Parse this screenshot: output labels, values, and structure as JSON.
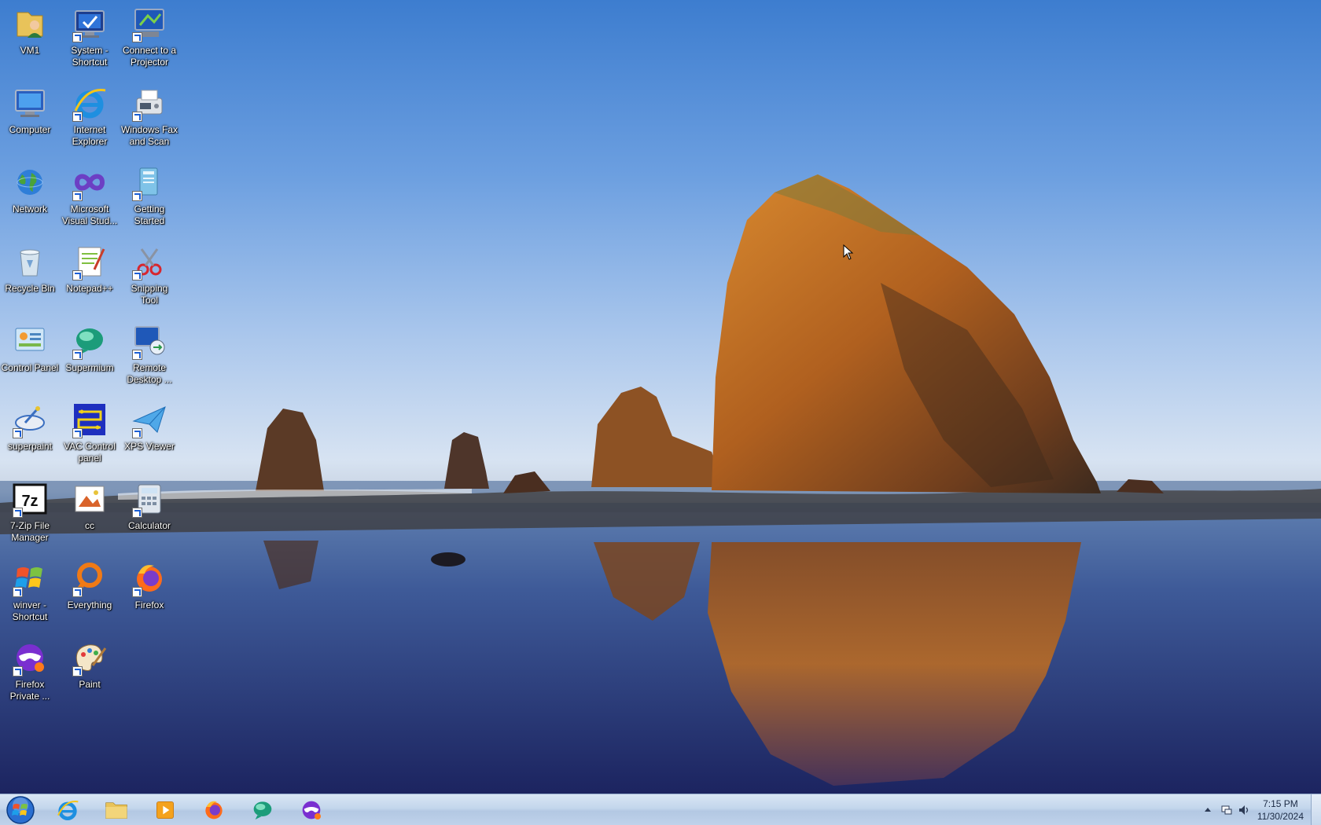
{
  "desktop": {
    "icons": [
      {
        "name": "vm1-icon",
        "label": "VM1",
        "icon": "user-folder",
        "shortcut": false
      },
      {
        "name": "system-shortcut-icon",
        "label": "System -\nShortcut",
        "icon": "system-monitor",
        "shortcut": true
      },
      {
        "name": "connect-projector-icon",
        "label": "Connect to a\nProjector",
        "icon": "projector-monitor",
        "shortcut": true
      },
      {
        "name": "computer-icon",
        "label": "Computer",
        "icon": "computer",
        "shortcut": false
      },
      {
        "name": "internet-explorer-icon",
        "label": "Internet\nExplorer",
        "icon": "ie",
        "shortcut": true
      },
      {
        "name": "windows-fax-icon",
        "label": "Windows Fax\nand Scan",
        "icon": "fax",
        "shortcut": true
      },
      {
        "name": "network-icon",
        "label": "Network",
        "icon": "globe",
        "shortcut": false
      },
      {
        "name": "visual-studio-icon",
        "label": "Microsoft\nVisual Stud...",
        "icon": "infinity",
        "shortcut": true
      },
      {
        "name": "getting-started-icon",
        "label": "Getting\nStarted",
        "icon": "getting-started",
        "shortcut": true
      },
      {
        "name": "recycle-bin-icon",
        "label": "Recycle Bin",
        "icon": "recycle-bin",
        "shortcut": false
      },
      {
        "name": "notepadpp-icon",
        "label": "Notepad++",
        "icon": "notepad",
        "shortcut": true
      },
      {
        "name": "snipping-tool-icon",
        "label": "Snipping\nTool",
        "icon": "scissors",
        "shortcut": true
      },
      {
        "name": "control-panel-icon",
        "label": "Control Panel",
        "icon": "control-panel",
        "shortcut": false
      },
      {
        "name": "supermium-icon",
        "label": "Supermium",
        "icon": "supermium",
        "shortcut": true
      },
      {
        "name": "remote-desktop-icon",
        "label": "Remote\nDesktop ...",
        "icon": "remote-desktop",
        "shortcut": true
      },
      {
        "name": "superpaint-icon",
        "label": "superpaint",
        "icon": "superpaint",
        "shortcut": true
      },
      {
        "name": "vac-control-panel-icon",
        "label": "VAC Control\npanel",
        "icon": "vac",
        "shortcut": true
      },
      {
        "name": "xps-viewer-icon",
        "label": "XPS Viewer",
        "icon": "paper-plane",
        "shortcut": true
      },
      {
        "name": "7zip-icon",
        "label": "7-Zip File\nManager",
        "icon": "7z",
        "shortcut": true
      },
      {
        "name": "cc-icon",
        "label": "cc",
        "icon": "image-file",
        "shortcut": false
      },
      {
        "name": "calculator-icon",
        "label": "Calculator",
        "icon": "calculator",
        "shortcut": true
      },
      {
        "name": "winver-shortcut-icon",
        "label": "winver -\nShortcut",
        "icon": "windows-flag",
        "shortcut": true
      },
      {
        "name": "everything-icon",
        "label": "Everything",
        "icon": "everything",
        "shortcut": true
      },
      {
        "name": "firefox-icon",
        "label": "Firefox",
        "icon": "firefox",
        "shortcut": true
      },
      {
        "name": "firefox-private-icon",
        "label": "Firefox\nPrivate ...",
        "icon": "firefox-private",
        "shortcut": true
      },
      {
        "name": "paint-icon",
        "label": "Paint",
        "icon": "paint",
        "shortcut": true
      }
    ]
  },
  "taskbar": {
    "pinned": [
      {
        "name": "taskbar-ie",
        "icon": "ie"
      },
      {
        "name": "taskbar-explorer",
        "icon": "folder"
      },
      {
        "name": "taskbar-media-player",
        "icon": "media"
      },
      {
        "name": "taskbar-firefox",
        "icon": "firefox"
      },
      {
        "name": "taskbar-supermium",
        "icon": "supermium"
      },
      {
        "name": "taskbar-firefox-private",
        "icon": "firefox-private"
      }
    ],
    "clock": {
      "time": "7:15 PM",
      "date": "11/30/2024"
    }
  },
  "colors": {
    "taskbar": "#c3d6ec",
    "label_text": "#ffffff",
    "start_orb": "#2a6fd1"
  }
}
